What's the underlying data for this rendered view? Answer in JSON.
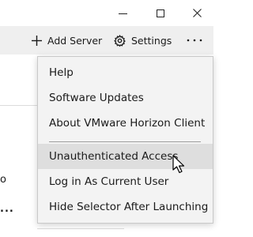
{
  "titlebar": {
    "minimize_icon": "minimize-icon",
    "maximize_icon": "maximize-icon",
    "close_icon": "close-icon"
  },
  "toolbar": {
    "add_server_label": "Add Server",
    "settings_label": "Settings",
    "more_label": "..."
  },
  "background": {
    "partial_text": "o",
    "ellipsis": "..."
  },
  "menu": {
    "items": [
      {
        "label": "Help"
      },
      {
        "label": "Software Updates"
      },
      {
        "label": "About VMware Horizon Client"
      },
      {
        "label": "Unauthenticated Access"
      },
      {
        "label": "Log in As Current User"
      },
      {
        "label": "Hide Selector After Launching"
      }
    ],
    "hovered_item": "Unauthenticated Access"
  }
}
